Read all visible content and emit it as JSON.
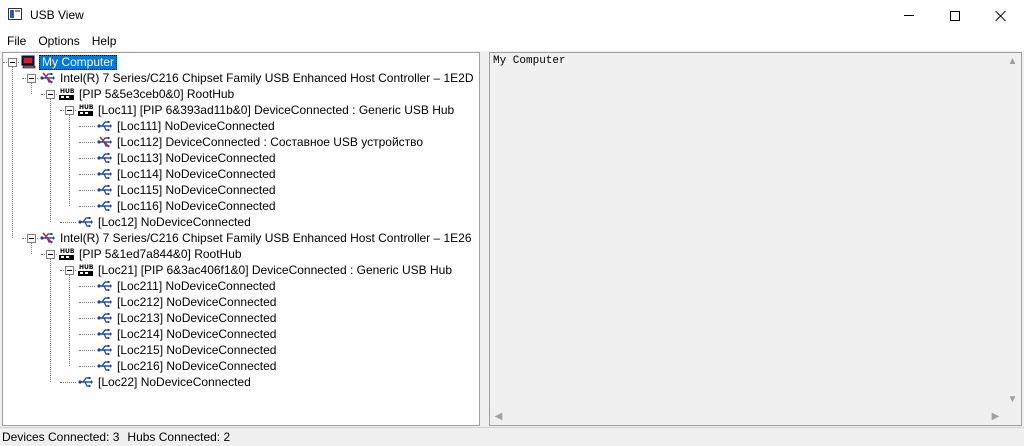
{
  "window": {
    "title": "USB View",
    "icon": "usbview-app-icon"
  },
  "menu": [
    "File",
    "Options",
    "Help"
  ],
  "tree": {
    "root": "My Computer",
    "controllers": [
      {
        "label": "Intel(R) 7 Series/C216 Chipset Family USB Enhanced Host Controller – 1E2D",
        "roothub": "[PIP 5&5e3ceb0&0] RootHub",
        "hub": "[Loc11] [PIP 6&393ad11b&0] DeviceConnected :  Generic USB Hub",
        "ports": [
          {
            "label": "[Loc111] NoDeviceConnected",
            "connected": false
          },
          {
            "label": "[Loc112] DeviceConnected :  Составное USB устройство",
            "connected": true
          },
          {
            "label": "[Loc113] NoDeviceConnected",
            "connected": false
          },
          {
            "label": "[Loc114] NoDeviceConnected",
            "connected": false
          },
          {
            "label": "[Loc115] NoDeviceConnected",
            "connected": false
          },
          {
            "label": "[Loc116] NoDeviceConnected",
            "connected": false
          }
        ],
        "extra_port": "[Loc12] NoDeviceConnected"
      },
      {
        "label": "Intel(R) 7 Series/C216 Chipset Family USB Enhanced Host Controller – 1E26",
        "roothub": "[PIP 5&1ed7a844&0] RootHub",
        "hub": "[Loc21] [PIP 6&3ac406f1&0] DeviceConnected :  Generic USB Hub",
        "ports": [
          {
            "label": "[Loc211] NoDeviceConnected",
            "connected": false
          },
          {
            "label": "[Loc212] NoDeviceConnected",
            "connected": false
          },
          {
            "label": "[Loc213] NoDeviceConnected",
            "connected": false
          },
          {
            "label": "[Loc214] NoDeviceConnected",
            "connected": false
          },
          {
            "label": "[Loc215] NoDeviceConnected",
            "connected": false
          },
          {
            "label": "[Loc216] NoDeviceConnected",
            "connected": false
          }
        ],
        "extra_port": "[Loc22] NoDeviceConnected"
      }
    ]
  },
  "detail": {
    "text": "My Computer"
  },
  "status": {
    "devices": "Devices Connected: 3",
    "hubs": "Hubs Connected: 2"
  },
  "colors": {
    "selection": "#0078d7",
    "usb_blue": "#1a3fa8",
    "usb_red": "#c0282d"
  },
  "icons": {
    "computer": "computer-icon",
    "controller": "usb-controller-icon",
    "hub": "usb-hub-icon",
    "port": "usb-port-icon",
    "device": "usb-device-icon"
  }
}
